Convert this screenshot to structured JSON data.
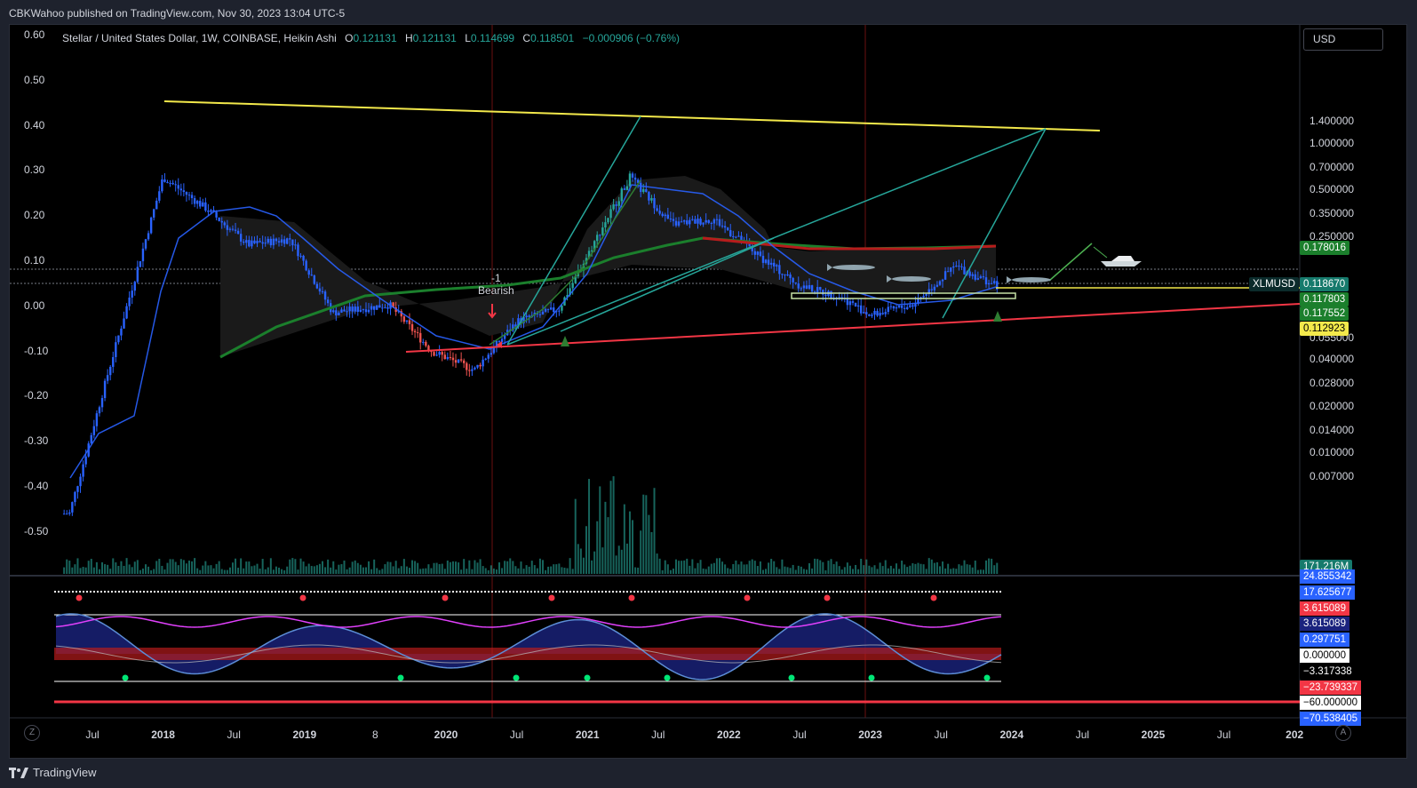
{
  "publish_line": "CBKWahoo published on TradingView.com, Nov 30, 2023 13:04 UTC-5",
  "legend": {
    "symbol": "Stellar / United States Dollar, 1W, COINBASE, Heikin Ashi",
    "o_label": "O",
    "o": "0.121131",
    "h_label": "H",
    "h": "0.121131",
    "l_label": "L",
    "l": "0.114699",
    "c_label": "C",
    "c": "0.118501",
    "change": "−0.000906 (−0.76%)"
  },
  "currency_button": "USD",
  "signal": {
    "count": "-1",
    "label": "Bearish"
  },
  "left_axis": [
    "0.60",
    "0.50",
    "0.40",
    "0.30",
    "0.20",
    "0.10",
    "0.00",
    "-0.10",
    "-0.20",
    "-0.30",
    "-0.40",
    "-0.50"
  ],
  "right_axis": [
    "1.400000",
    "1.000000",
    "0.700000",
    "0.500000",
    "0.350000",
    "0.250000",
    "0.055000",
    "0.040000",
    "0.028000",
    "0.020000",
    "0.014000",
    "0.010000",
    "0.007000"
  ],
  "price_tags": [
    {
      "text": "0.178016",
      "bg": "#1b7f2c",
      "fg": "#ffffff"
    },
    {
      "text": "XLMUSD",
      "bg": "#0b2b2b",
      "fg": "#ffffff"
    },
    {
      "text": "0.118670",
      "bg": "#167a6c",
      "fg": "#ffffff"
    },
    {
      "text": "0.117803",
      "bg": "#1b7f2c",
      "fg": "#ffffff"
    },
    {
      "text": "0.117552",
      "bg": "#1b7f2c",
      "fg": "#ffffff"
    },
    {
      "text": "0.112923",
      "bg": "#f3e94b",
      "fg": "#000000"
    },
    {
      "text": "171.216M",
      "bg": "#167a6c",
      "fg": "#ffffff"
    }
  ],
  "osc_tags": [
    {
      "text": "24.855342",
      "bg": "#2962ff",
      "fg": "#ffffff"
    },
    {
      "text": "17.625677",
      "bg": "#2962ff",
      "fg": "#ffffff"
    },
    {
      "text": "3.615089",
      "bg": "#f23645",
      "fg": "#ffffff"
    },
    {
      "text": "3.615089",
      "bg": "#1a237e",
      "fg": "#ffffff"
    },
    {
      "text": "0.297751",
      "bg": "#2962ff",
      "fg": "#ffffff"
    },
    {
      "text": "0.000000",
      "bg": "#ffffff",
      "fg": "#000000"
    },
    {
      "text": "−3.317338",
      "bg": "#000000",
      "fg": "#ffffff"
    },
    {
      "text": "−23.739337",
      "bg": "#f23645",
      "fg": "#ffffff"
    },
    {
      "text": "−60.000000",
      "bg": "#ffffff",
      "fg": "#000000"
    },
    {
      "text": "−70.538405",
      "bg": "#2962ff",
      "fg": "#ffffff"
    }
  ],
  "x_axis": [
    {
      "label": "Jul",
      "strong": false
    },
    {
      "label": "2018",
      "strong": true
    },
    {
      "label": "Jul",
      "strong": false
    },
    {
      "label": "2019",
      "strong": true
    },
    {
      "label": "8",
      "strong": false
    },
    {
      "label": "2020",
      "strong": true
    },
    {
      "label": "Jul",
      "strong": false
    },
    {
      "label": "2021",
      "strong": true
    },
    {
      "label": "Jul",
      "strong": false
    },
    {
      "label": "2022",
      "strong": true
    },
    {
      "label": "Jul",
      "strong": false
    },
    {
      "label": "2023",
      "strong": true
    },
    {
      "label": "Jul",
      "strong": false
    },
    {
      "label": "2024",
      "strong": true
    },
    {
      "label": "Jul",
      "strong": false
    },
    {
      "label": "2025",
      "strong": true
    },
    {
      "label": "Jul",
      "strong": false
    },
    {
      "label": "202",
      "strong": true
    }
  ],
  "buttons": {
    "left": "Z",
    "right": "A"
  },
  "footer": "TradingView",
  "colors": {
    "up": "#26a69a",
    "down": "#ef5350",
    "candle_main": "#2962ff",
    "resistance": "#f3e94b",
    "support": "#f23645",
    "channel": "#26a69a",
    "ma_green": "#1b7f2c",
    "ma_red": "#b71c1c"
  },
  "chart_data": {
    "type": "line",
    "title": "Stellar / United States Dollar, 1W, COINBASE, Heikin Ashi",
    "x": [
      2017.3,
      2017.6,
      2018.0,
      2018.3,
      2018.6,
      2018.9,
      2019.2,
      2019.6,
      2019.9,
      2020.2,
      2020.5,
      2020.8,
      2021.1,
      2021.3,
      2021.6,
      2021.9,
      2022.2,
      2022.5,
      2022.8,
      2023.0,
      2023.3,
      2023.6,
      2023.9
    ],
    "series": [
      {
        "values": [
          0.003,
          0.03,
          0.6,
          0.38,
          0.22,
          0.24,
          0.08,
          0.09,
          0.045,
          0.034,
          0.07,
          0.085,
          0.28,
          0.6,
          0.3,
          0.32,
          0.19,
          0.12,
          0.1,
          0.077,
          0.09,
          0.16,
          0.1185
        ]
      }
    ],
    "ylim": [
      0.005,
      1.6
    ],
    "log_scale": true,
    "grid": false
  }
}
